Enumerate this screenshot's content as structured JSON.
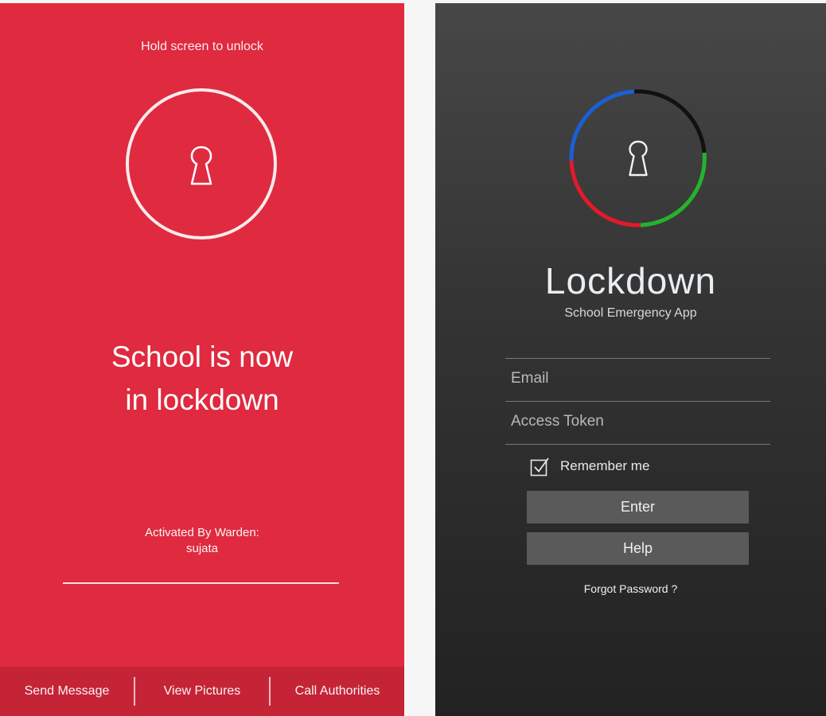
{
  "lockdown_screen": {
    "hint": "Hold screen to unlock",
    "headline_line1": "School is now",
    "headline_line2": "in lockdown",
    "activated_label": "Activated By Warden:",
    "warden_name": "sujata",
    "actions": [
      "Send Message",
      "View Pictures",
      "Call Authorities"
    ],
    "background_color": "#df2a3f",
    "actionbar_color": "#c42436"
  },
  "login_screen": {
    "app_name": "Lockdown",
    "app_subtitle": "School Emergency App",
    "email_placeholder": "Email",
    "token_placeholder": "Access Token",
    "remember_label": "Remember me",
    "remember_checked": true,
    "enter_label": "Enter",
    "help_label": "Help",
    "forgot_label": "Forgot Password ?",
    "logo_ring_colors": [
      "#1b5fd6",
      "#111111",
      "#25b22e",
      "#e11b2b"
    ]
  }
}
